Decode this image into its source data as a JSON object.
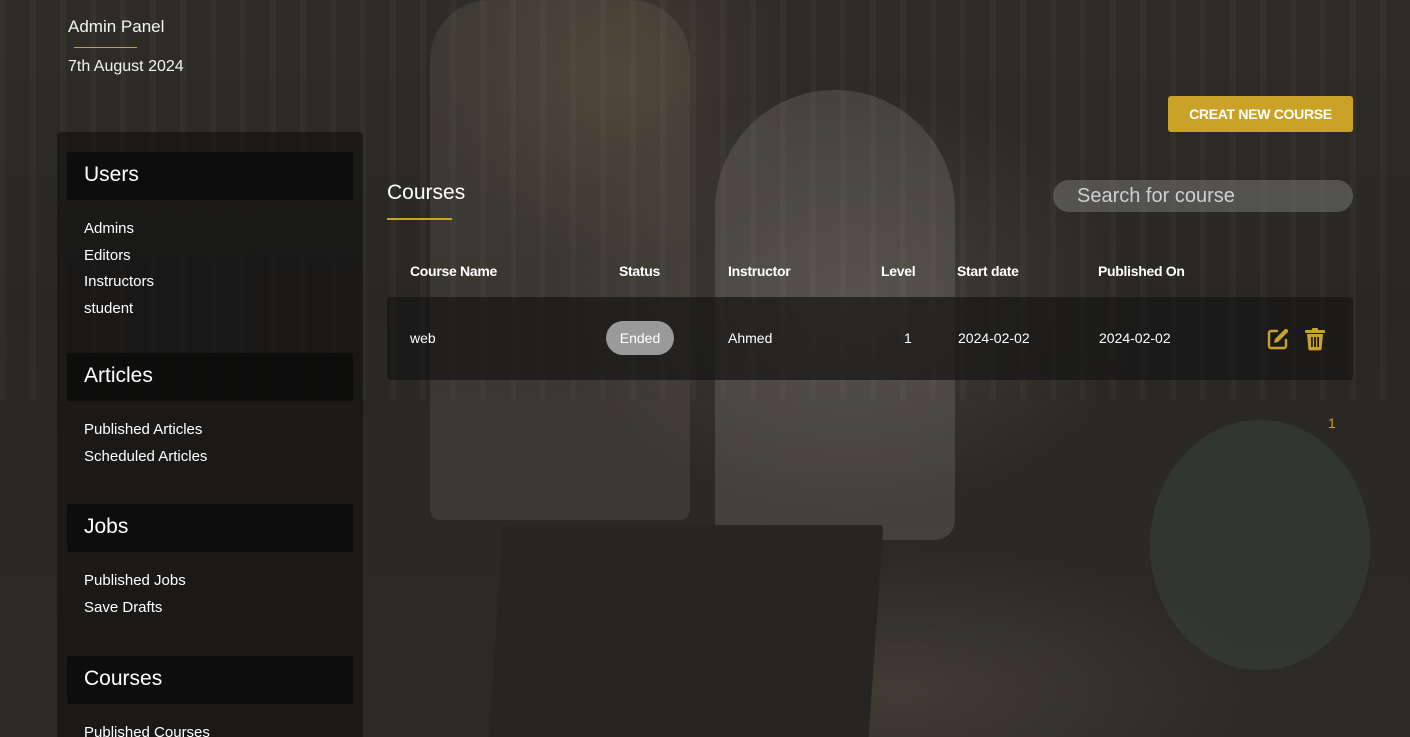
{
  "brand": {
    "title": "Admin Panel",
    "date": "7th August 2024"
  },
  "sidebar": {
    "sections": [
      {
        "title": "Users",
        "items": [
          "Admins",
          "Editors",
          "Instructors",
          "student"
        ]
      },
      {
        "title": "Articles",
        "items": [
          "Published Articles",
          "Scheduled Articles"
        ]
      },
      {
        "title": "Jobs",
        "items": [
          "Published Jobs",
          "Save Drafts"
        ]
      },
      {
        "title": "Courses",
        "items": [
          "Published Courses"
        ]
      }
    ]
  },
  "toolbar": {
    "create_label": "CREAT NEW COURSE"
  },
  "main": {
    "title": "Courses",
    "search": {
      "placeholder": "Search for course",
      "value": ""
    },
    "table": {
      "headers": [
        "Course Name",
        "Status",
        "Instructor",
        "Level",
        "Start date",
        "Published On"
      ],
      "rows": [
        {
          "name": "web",
          "status": "Ended",
          "instructor": "Ahmed",
          "level": "1",
          "start": "2024-02-02",
          "published": "2024-02-02"
        }
      ]
    },
    "pagination": {
      "current": "1"
    }
  },
  "icons": {
    "edit": "edit-icon",
    "delete": "trash-icon",
    "search": "search-icon"
  },
  "colors": {
    "accent": "#c9a227",
    "badge": "#9a9a9a"
  }
}
